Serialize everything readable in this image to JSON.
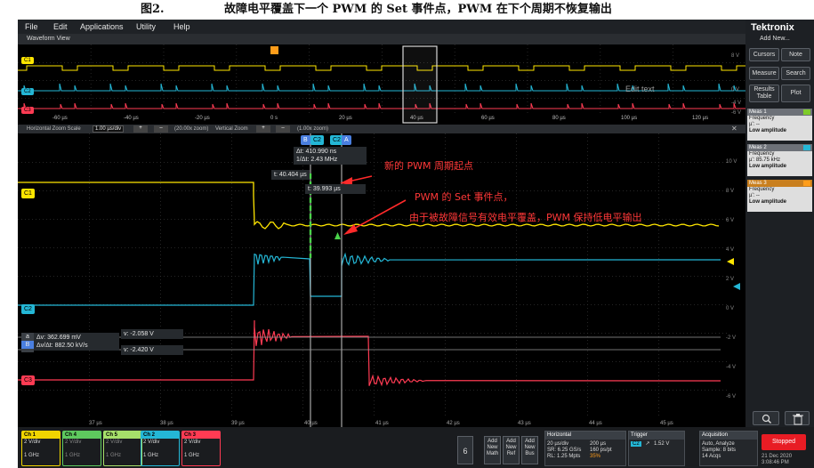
{
  "figure": {
    "number": "图2.",
    "caption": "故障电平覆盖下一个 PWM 的 Set 事件点，PWM 在下个周期不恢复输出"
  },
  "menu": [
    "File",
    "Edit",
    "Applications",
    "Utility",
    "Help"
  ],
  "waveform_view_label": "Waveform View",
  "overview": {
    "time_ticks": [
      "-60 µs",
      "-40 µs",
      "-20 µs",
      "0 s",
      "20 µs",
      "40 µs",
      "60 µs",
      "80 µs",
      "100 µs",
      "120 µs"
    ],
    "right_volts": [
      "8 V",
      "0 V",
      "-4 V",
      "-6 V"
    ],
    "edit_text": "Edit text",
    "ch_badges": [
      "C1",
      "C2",
      "C3"
    ]
  },
  "zoom_bar": {
    "horizontal_label": "Horizontal Zoom Scale",
    "horizontal_value": "1.00 µs/div",
    "horizontal_zoom": "(20.00x zoom)",
    "vertical_label": "Vertical Zoom",
    "vertical_zoom": "(1.00x zoom)",
    "plus": "+",
    "minus": "–",
    "close": "✕"
  },
  "main_plot": {
    "time_ticks": [
      "37 µs",
      "38 µs",
      "39 µs",
      "40 µs",
      "41 µs",
      "42 µs",
      "43 µs",
      "44 µs",
      "45 µs"
    ],
    "right_volts": [
      "10 V",
      "8 V",
      "6 V",
      "4 V",
      "2 V",
      "0 V",
      "-2 V",
      "-4 V",
      "-6 V"
    ],
    "ch_badges": [
      "C1",
      "C2",
      "C3"
    ],
    "cursor_labels": [
      "B",
      "C2",
      "A"
    ],
    "cursor_readout": {
      "delta_t": "Δt: 410.990 ns",
      "inv_delta_t": "1/Δt: 2.43 MHz",
      "t_b": "t: 40.404 µs",
      "t_a": "t: 39.993 µs"
    },
    "volt_readout": {
      "a_label": "a",
      "b_label": "B",
      "delta_v": "Δv: 362.699 mV",
      "dv_dt": "Δv/Δt: 882.50 kV/s",
      "v_top": "v: -2.058 V",
      "v_bottom": "v: -2.420 V"
    },
    "annotations": {
      "new_cycle": "新的 PWM 周期起点",
      "set_event": "PWM 的 Set 事件点，",
      "explanation": "由于被故障信号有效电平覆盖，PWM 保持低电平输出"
    },
    "colors": {
      "ch1": "#ffe600",
      "ch2": "#24b7d6",
      "ch3": "#ff3b53",
      "annotation": "#ff3838",
      "cursor": "#4ad24a"
    }
  },
  "right_panel": {
    "brand": "Tektronix",
    "add_new": "Add New...",
    "buttons": [
      "Cursors",
      "Note",
      "Measure",
      "Search",
      "Results Table",
      "Plot"
    ],
    "meas": [
      {
        "title": "Meas 1",
        "line1": "Frequency",
        "line2": "µ': --",
        "line3": "Low amplitude",
        "color": "#c8c8c8",
        "tag": "#7ecb2a"
      },
      {
        "title": "Meas 2",
        "line1": "Frequency",
        "line2": "µ': 85.75 kHz",
        "line3": "Low amplitude",
        "color": "#6d7178",
        "tag": "#24b7d6"
      },
      {
        "title": "Meas 3",
        "line1": "Frequency",
        "line2": "µ': --",
        "line3": "Low amplitude",
        "color": "#c97f1e",
        "tag": "#ff9d1a"
      }
    ]
  },
  "bottom_bar": {
    "channels": [
      {
        "name": "Ch 1",
        "scale": "2 V/div",
        "bw": "1 GHz",
        "color": "#f0d400"
      },
      {
        "name": "Ch 4",
        "scale": "2 V/div",
        "bw": "1 GHz",
        "color": "#5ec95e"
      },
      {
        "name": "Ch 5",
        "scale": "2 V/div",
        "bw": "1 GHz",
        "color": "#a6df6a"
      },
      {
        "name": "Ch 2",
        "scale": "2 V/div",
        "bw": "1 GHz",
        "color": "#24b7d6"
      },
      {
        "name": "Ch 3",
        "scale": "2 V/div",
        "bw": "1 GHz",
        "color": "#ff3b53"
      }
    ],
    "num_button": "6",
    "math_buttons": [
      "Add New Math",
      "Add New Ref",
      "Add New Bus"
    ],
    "horizontal": {
      "title": "Horizontal",
      "line1": "20 µs/div",
      "line1b": "200 µs",
      "line2": "SR: 6.25 GS/s",
      "line2b": "160 ps/pt",
      "line3": "RL: 1.25 Mpts",
      "line3b": "35%"
    },
    "trigger": {
      "title": "Trigger",
      "src": "C2",
      "level": "1.52 V"
    },
    "acquisition": {
      "title": "Acquisition",
      "line1": "Auto,",
      "line1b": "Analyze",
      "line2": "Sample: 8 bits",
      "line3": "14 Acqs"
    },
    "stopped": "Stopped",
    "date": "21 Dec 2020",
    "time": "3:08:46 PM"
  }
}
